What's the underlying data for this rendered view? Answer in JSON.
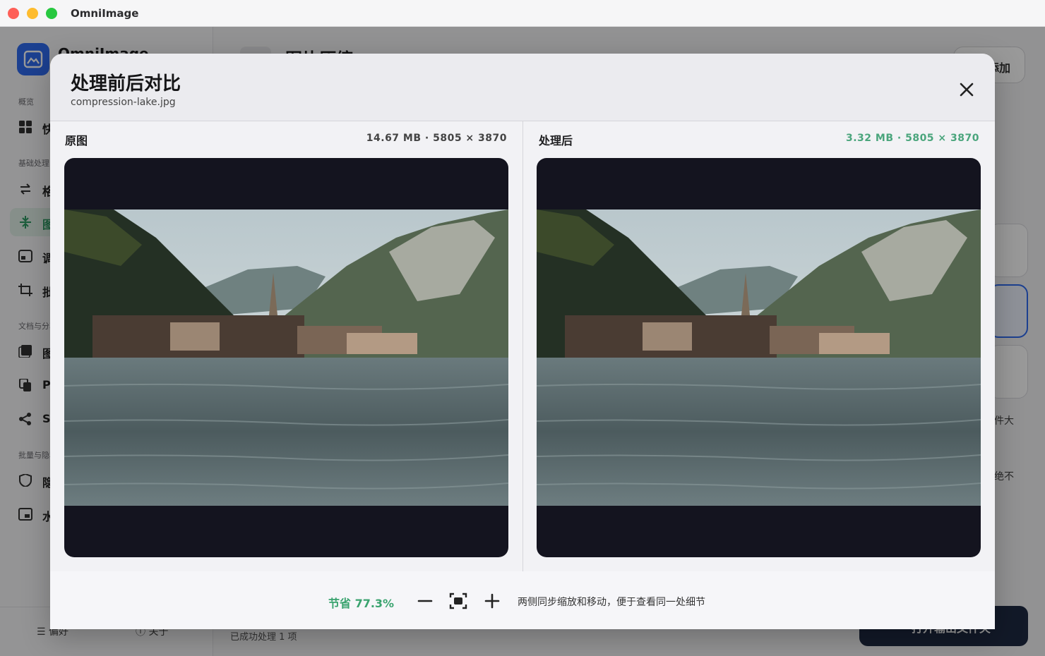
{
  "window": {
    "title": "OmniImage"
  },
  "sidebar": {
    "brand": "OmniImage",
    "sections": [
      "概览",
      "基础处理",
      "文档与分享",
      "批量与隐私"
    ],
    "items": [
      {
        "icon": "grid-icon",
        "label": "快"
      },
      {
        "icon": "swap-arrows-icon",
        "label": "格"
      },
      {
        "icon": "compress-icon",
        "label": "图",
        "active": true
      },
      {
        "icon": "resize-icon",
        "label": "调"
      },
      {
        "icon": "crop-icon",
        "label": "批"
      },
      {
        "icon": "pdf-icon",
        "label": "图"
      },
      {
        "icon": "copy-icon",
        "label": "P"
      },
      {
        "icon": "share-icon",
        "label": "S"
      },
      {
        "icon": "shield-icon",
        "label": "隐"
      },
      {
        "icon": "watermark-icon",
        "label": "水"
      }
    ],
    "footer": {
      "prefs": "偏好",
      "about": "关于"
    }
  },
  "main": {
    "title": "图片压缩",
    "add_button": "添加",
    "option_text_1": "件大",
    "option_text_2": "绝不",
    "status": "已成功处理 1 项",
    "open_button": "打开输出文件夹"
  },
  "modal": {
    "title": "处理前后对比",
    "filename": "compression-lake.jpg",
    "original": {
      "label": "原图",
      "meta": "14.67 MB · 5805 × 3870"
    },
    "processed": {
      "label": "处理后",
      "meta": "3.32 MB · 5805 × 3870"
    },
    "saving": "节省 77.3%",
    "hint": "两侧同步缩放和移动，便于查看同一处细节",
    "accent_green": "#3aa36f"
  }
}
